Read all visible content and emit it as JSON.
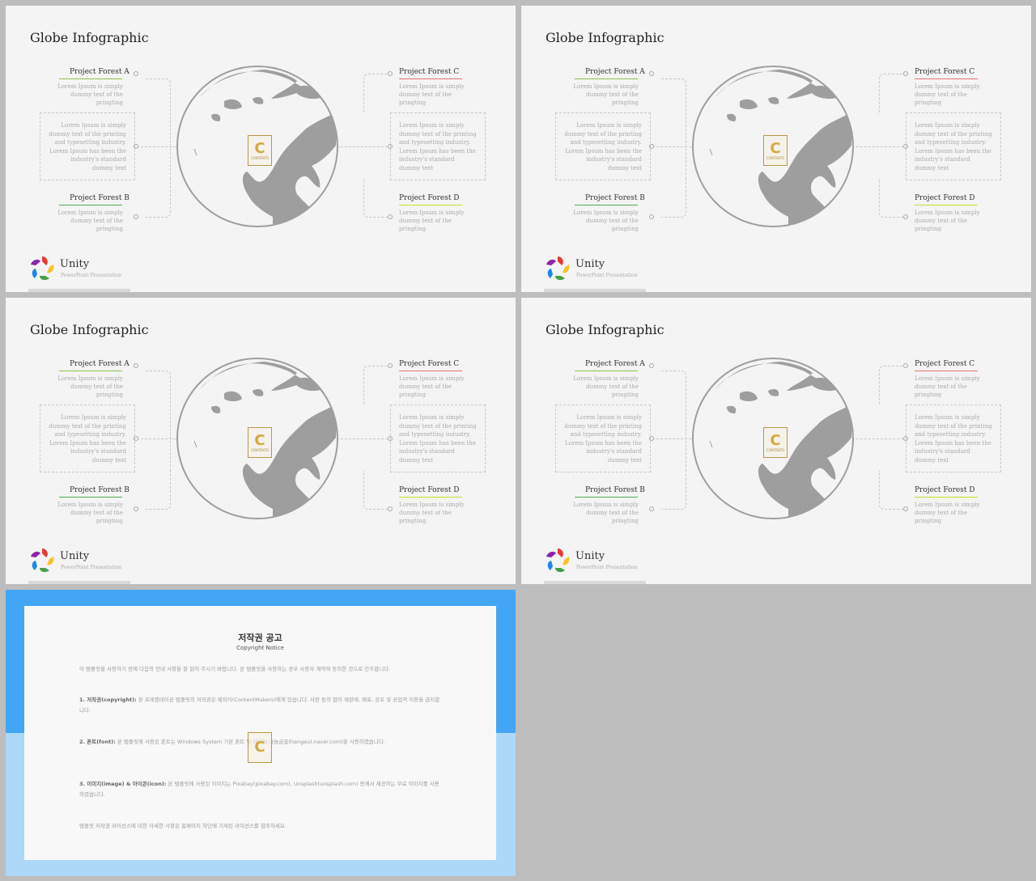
{
  "slide": {
    "title": "Globe Infographic",
    "project_a": {
      "title": "Project Forest A",
      "desc": "Lorem Ipsum is simply dummy text of the pringting",
      "color": "#8bc34a"
    },
    "project_b": {
      "title": "Project Forest B",
      "desc": "Lorem Ipsum is simply dummy text of the pringting",
      "color": "#4caf50"
    },
    "project_c": {
      "title": "Project Forest C",
      "desc": "Lorem Ipsum is simply dummy text of the pringting",
      "color": "#e57373"
    },
    "project_d": {
      "title": "Project Forest D",
      "desc": "Lorem Ipsum is simply dummy text of the pringting",
      "color": "#cddc39"
    },
    "box_text": "Lorem Ipsum is simply dummy text of the printing and typesetting industry. Lorem Ipsum has been the industry's standard dummy text",
    "badge_letter": "C",
    "badge_sub": "CONTENTS",
    "brand": "Unity",
    "brand_sub": "PowerPoint Presentation"
  },
  "copyright": {
    "title": "저작권 공고",
    "subtitle": "Copyright Notice",
    "intro": "이 템플릿을 사용하기 전에 다음의 안내 사항을 잘 읽어 주시기 바랍니다. 본 템플릿을 사용하는 경우 사용자 계약에 동의한 것으로 간주합니다.",
    "font_heading": "1. 저작권(copyright):",
    "p1": "본 프레젠테이션 템플릿의 저작권은 제작자(ContentMakers)에게 있습니다. 사전 동의 없이 재판매, 배포, 공유 및 상업적 이용을 금지합니다.",
    "p2_heading": "2. 폰트(font):",
    "p2": "본 템플릿에 사용된 폰트는 Windows System 기본 폰트 및 네이버 나눔글꼴(hangeul.naver.com)을 사용하였습니다.",
    "p3_heading": "3. 이미지(image) & 아이콘(icon):",
    "p3": "본 템플릿에 사용된 이미지는 Pixabay(pixabay.com), Unsplash(unsplash.com) 등에서 제공하는 무료 이미지를 사용하였습니다.",
    "footer": "템플릿 저작권 라이선스에 대한 자세한 사항은 홈페이지 하단에 기재된 라이선스를 참조하세요."
  }
}
